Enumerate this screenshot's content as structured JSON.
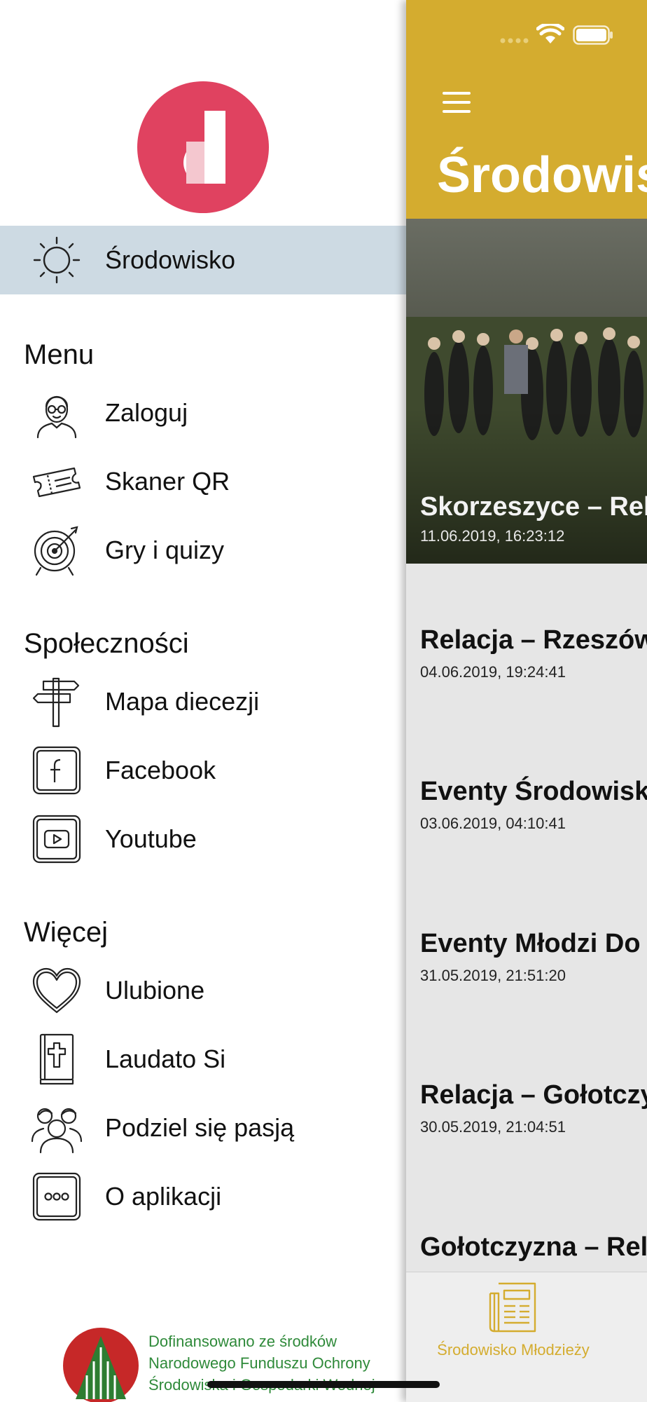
{
  "drawer": {
    "selected": {
      "label": "Środowisko",
      "icon": "sun-icon"
    },
    "sections": [
      {
        "title": "Menu",
        "items": [
          {
            "label": "Zaloguj",
            "icon": "user-avatar-icon"
          },
          {
            "label": "Skaner QR",
            "icon": "ticket-icon"
          },
          {
            "label": "Gry i quizy",
            "icon": "target-icon"
          }
        ]
      },
      {
        "title": "Społeczności",
        "items": [
          {
            "label": "Mapa diecezji",
            "icon": "signpost-icon"
          },
          {
            "label": "Facebook",
            "icon": "facebook-icon"
          },
          {
            "label": "Youtube",
            "icon": "youtube-icon"
          }
        ]
      },
      {
        "title": "Więcej",
        "items": [
          {
            "label": "Ulubione",
            "icon": "heart-icon"
          },
          {
            "label": "Laudato Si",
            "icon": "bible-icon"
          },
          {
            "label": "Podziel się pasją",
            "icon": "people-icon"
          },
          {
            "label": "O aplikacji",
            "icon": "more-icon"
          }
        ]
      }
    ],
    "funding_text": "Dofinansowano ze środków Narodowego Funduszu Ochrony Środowiska i Gospodarki Wodnej"
  },
  "content": {
    "title": "Środowisko",
    "hero": {
      "title": "Skorzeszyce – Relacja",
      "date": "11.06.2019, 16:23:12"
    },
    "news": [
      {
        "title": "Relacja – Rzeszów",
        "date": "04.06.2019, 19:24:41"
      },
      {
        "title": "Eventy Środowisko",
        "date": "03.06.2019, 04:10:41"
      },
      {
        "title": "Eventy Młodzi Do",
        "date": "31.05.2019, 21:51:20"
      },
      {
        "title": "Relacja – Gołotczyzna",
        "date": "30.05.2019, 21:04:51"
      },
      {
        "title": "Gołotczyzna – Relacja",
        "date": ""
      }
    ],
    "tab_label": "Środowisko Młodzieży"
  },
  "colors": {
    "accent": "#d4ac2f",
    "logo": "#e04260",
    "selected_row": "#cddae3",
    "funding_green": "#2f8a3a"
  }
}
